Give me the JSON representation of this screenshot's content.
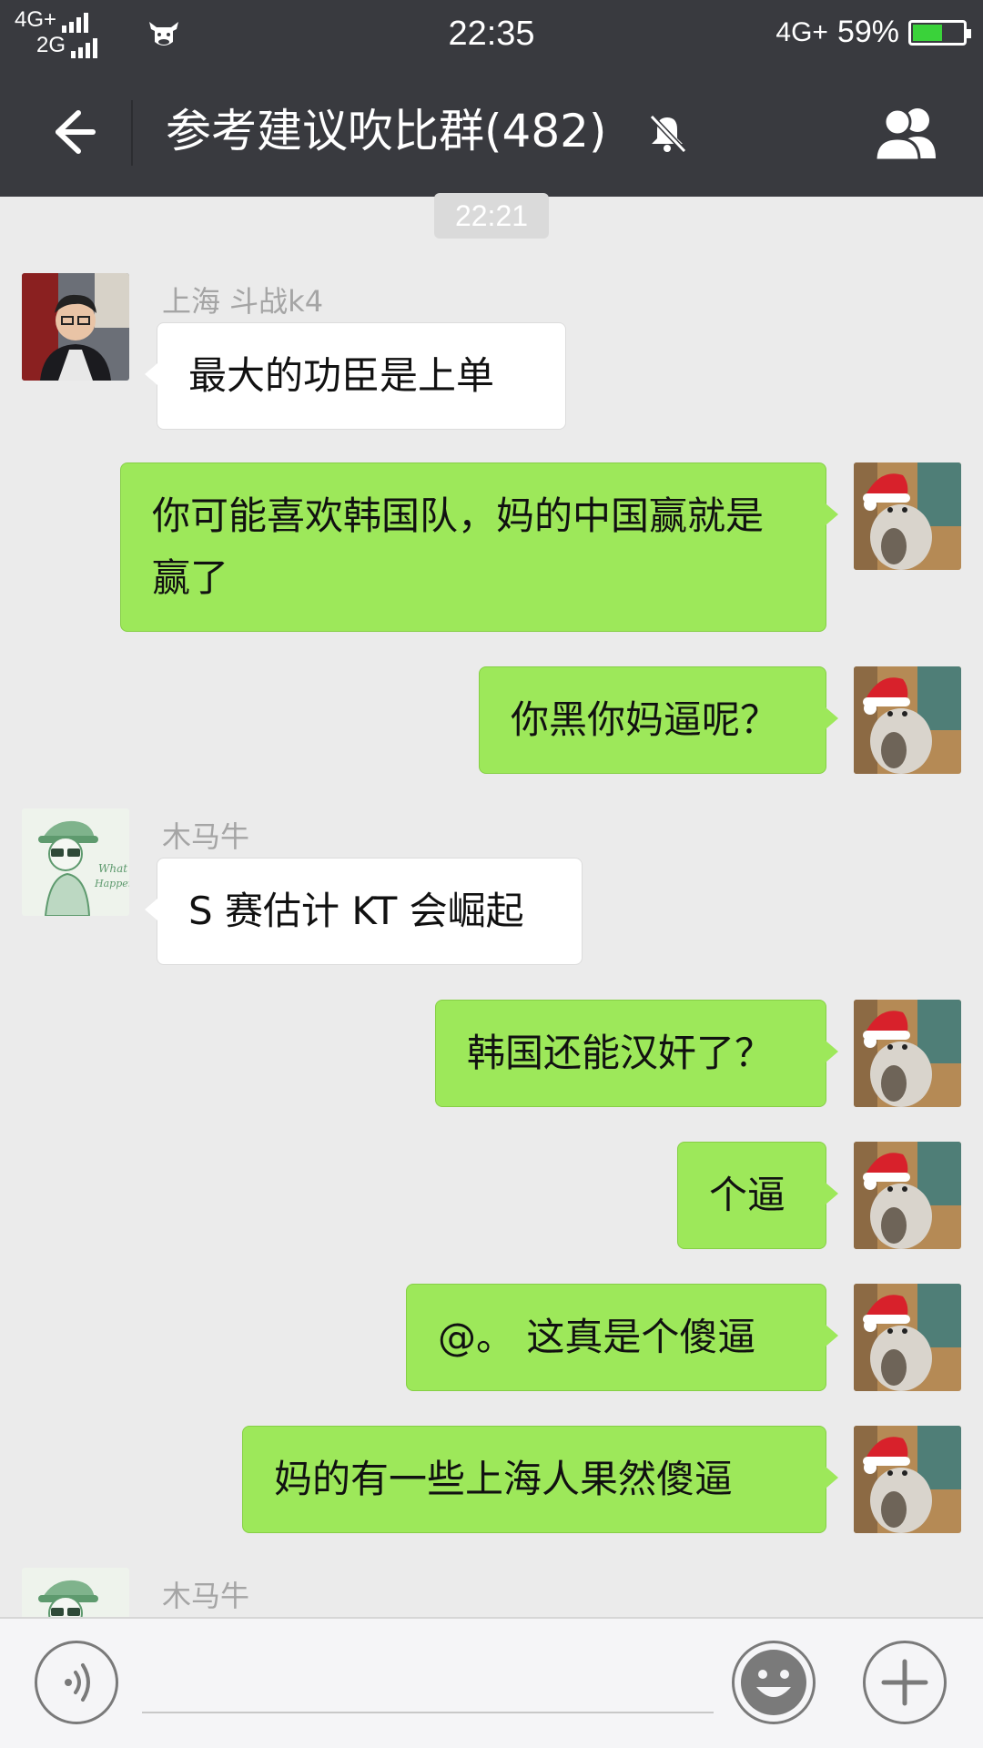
{
  "status_bar": {
    "network_top": "4G+",
    "network_bottom": "2G",
    "time": "22:35",
    "network_right": "4G+",
    "battery_percent": "59%",
    "battery_level": 0.59,
    "notification_icon": "cow-app-icon"
  },
  "header": {
    "title": "参考建议吹比群(482)",
    "back_icon": "arrow-left-icon",
    "mute_icon": "bell-off-icon",
    "members_icon": "group-people-icon"
  },
  "time_divider": "22:21",
  "messages": [
    {
      "side": "left",
      "sender": "上海 斗战k4",
      "text": "最大的功臣是上单"
    },
    {
      "side": "right",
      "text": "你可能喜欢韩国队，妈的中国赢就是赢了"
    },
    {
      "side": "right",
      "text": "你黑你妈逼呢？"
    },
    {
      "side": "left",
      "sender": "木马牛",
      "text": "S 赛估计 KT 会崛起"
    },
    {
      "side": "right",
      "text": "韩国还能汉奸了？"
    },
    {
      "side": "right",
      "text": "个逼"
    },
    {
      "side": "right",
      "text": "@。 这真是个傻逼"
    },
    {
      "side": "right",
      "text": "妈的有一些上海人果然傻逼"
    },
    {
      "side": "left",
      "sender": "木马牛",
      "text": ""
    }
  ],
  "input_bar": {
    "voice_icon": "voice-wave-icon",
    "emoji_icon": "smiley-icon",
    "plus_icon": "plus-icon",
    "placeholder": ""
  },
  "colors": {
    "header_bg": "#393a3f",
    "chat_bg": "#ebebeb",
    "bubble_self": "#9de85a",
    "bubble_other": "#ffffff"
  }
}
